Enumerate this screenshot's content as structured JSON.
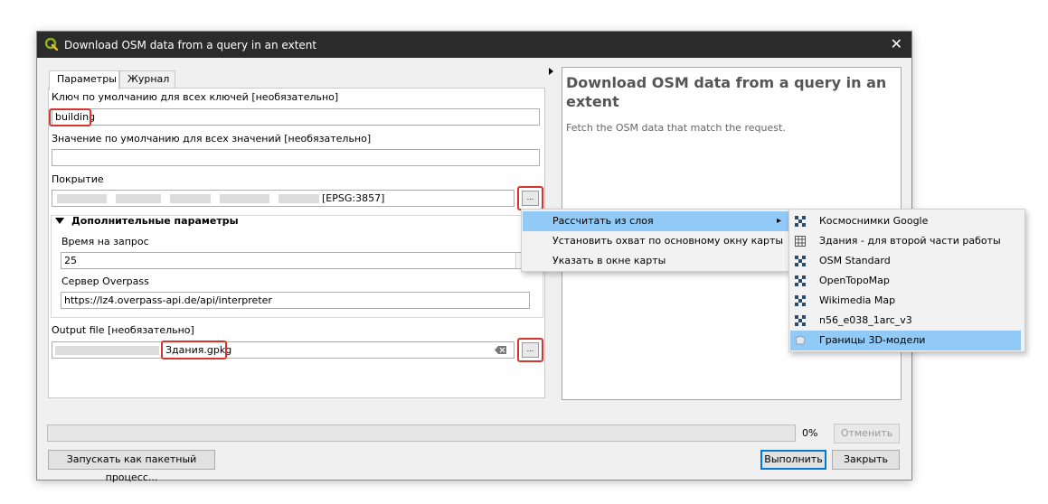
{
  "window": {
    "title": "Download OSM data from a query in an extent",
    "close_glyph": "✕"
  },
  "tabs": [
    {
      "label": "Параметры"
    },
    {
      "label": "Журнал"
    }
  ],
  "params": {
    "key_label": "Ключ по умолчанию для всех ключей [необязательно]",
    "key_value": "building",
    "value_label": "Значение по умолчанию для всех значений [необязательно]",
    "value_value": "",
    "extent_label": "Покрытие",
    "extent_crs": "[EPSG:3857]",
    "extent_button": "...",
    "advanced_label": "Дополнительные параметры",
    "timeout_label": "Время на запрос",
    "timeout_value": "25",
    "server_label": "Сервер Overpass",
    "server_value": "https://lz4.overpass-api.de/api/interpreter",
    "output_label": "Output file [необязательно]",
    "output_value": "Здания.gpkg",
    "output_button": "..."
  },
  "help": {
    "title": "Download OSM data from a query in an extent",
    "description": "Fetch the OSM data that match the request."
  },
  "footer": {
    "progress_text": "0%",
    "progress_value": 0,
    "cancel": "Отменить",
    "batch": "Запускать как пакетный процесс...",
    "run": "Выполнить",
    "close": "Закрыть"
  },
  "extent_menu": {
    "items": [
      {
        "label": "Рассчитать из слоя",
        "has_submenu": true,
        "selected": true
      },
      {
        "label": "Установить охват по основному окну карты"
      },
      {
        "label": "Указать в окне карты"
      }
    ],
    "submenu_arrow": "▸"
  },
  "layer_menu": {
    "items": [
      {
        "label": "Космоснимки Google",
        "icon": "raster-layer-icon"
      },
      {
        "label": "Здания - для второй части работы",
        "icon": "table-layer-icon"
      },
      {
        "label": "OSM Standard",
        "icon": "raster-layer-icon"
      },
      {
        "label": "OpenTopoMap",
        "icon": "raster-layer-icon"
      },
      {
        "label": "Wikimedia Map",
        "icon": "raster-layer-icon"
      },
      {
        "label": "n56_e038_1arc_v3",
        "icon": "raster-layer-icon"
      },
      {
        "label": "Границы 3D-модели",
        "icon": "polygon-layer-icon",
        "selected": true
      }
    ]
  },
  "colors": {
    "highlight": "#d9342b",
    "menu_selection": "#91c9f7",
    "titlebar": "#2b2b2b",
    "qgis_green": "#589632"
  }
}
